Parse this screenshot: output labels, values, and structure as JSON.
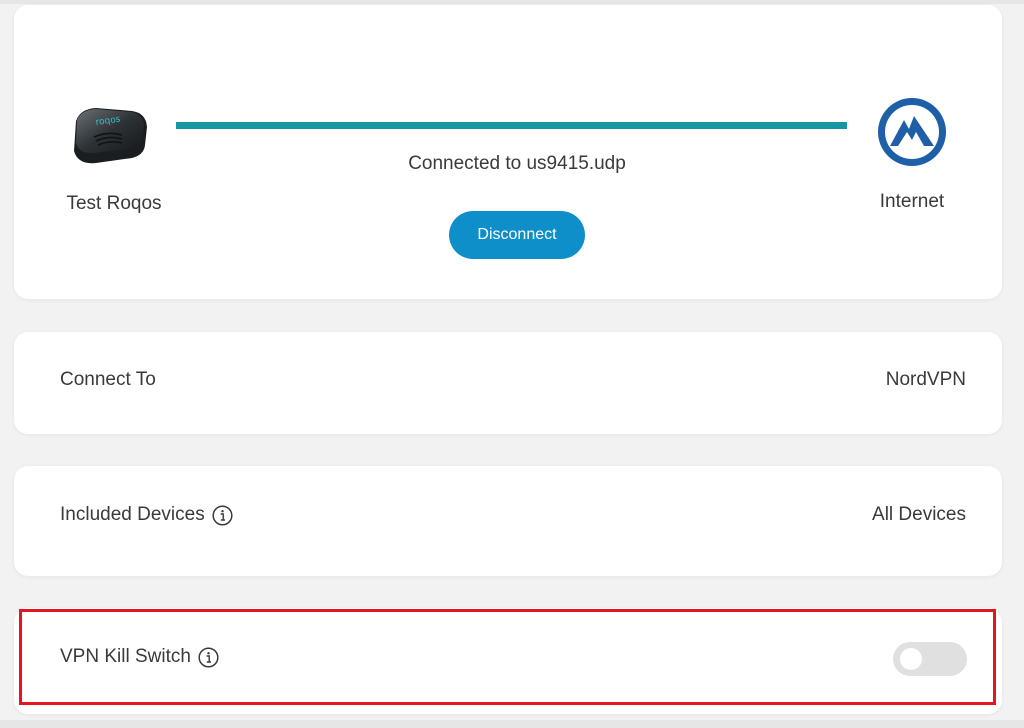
{
  "colors": {
    "accent_line": "#1497a3",
    "button_bg": "#0e8fc9",
    "highlight_border": "#e3151e",
    "toggle_off": "#e0e0e0"
  },
  "status": {
    "device_label": "Test Roqos",
    "device_icon": "router-icon",
    "connection_text": "Connected to us9415.udp",
    "disconnect_label": "Disconnect",
    "internet_label": "Internet",
    "internet_icon": "nordvpn-logo-icon"
  },
  "settings": {
    "connect_to": {
      "label": "Connect To",
      "value": "NordVPN"
    },
    "included_devices": {
      "label": "Included Devices",
      "value": "All Devices",
      "info_icon": "info-icon"
    },
    "kill_switch": {
      "label": "VPN Kill Switch",
      "info_icon": "info-icon",
      "enabled": false
    }
  }
}
